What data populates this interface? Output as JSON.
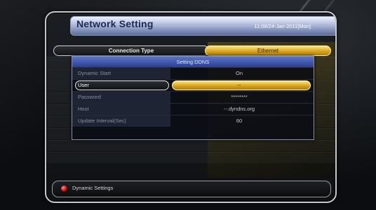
{
  "header": {
    "title": "Network Setting",
    "datetime": "11:08/24-Jan-2011[Mon]"
  },
  "connection": {
    "label": "Connection Type",
    "value": "Ethernet"
  },
  "dialog": {
    "title": "Setting DDNS",
    "rows": [
      {
        "label": "Dynamic Start",
        "value": "On"
      },
      {
        "label": "User",
        "value": "--"
      },
      {
        "label": "Password",
        "value": "********"
      },
      {
        "label": "Host",
        "value": "--.dyndns.org"
      },
      {
        "label": "Update Interval(Sec)",
        "value": "60"
      }
    ],
    "selected_index": 1
  },
  "footer": {
    "hint": "Dynamic Settings",
    "hint_icon": "red-button-icon"
  },
  "colors": {
    "accent_gold": "#d9a51f",
    "title_blue": "#2b3f8f",
    "hint_red": "#c40000"
  }
}
